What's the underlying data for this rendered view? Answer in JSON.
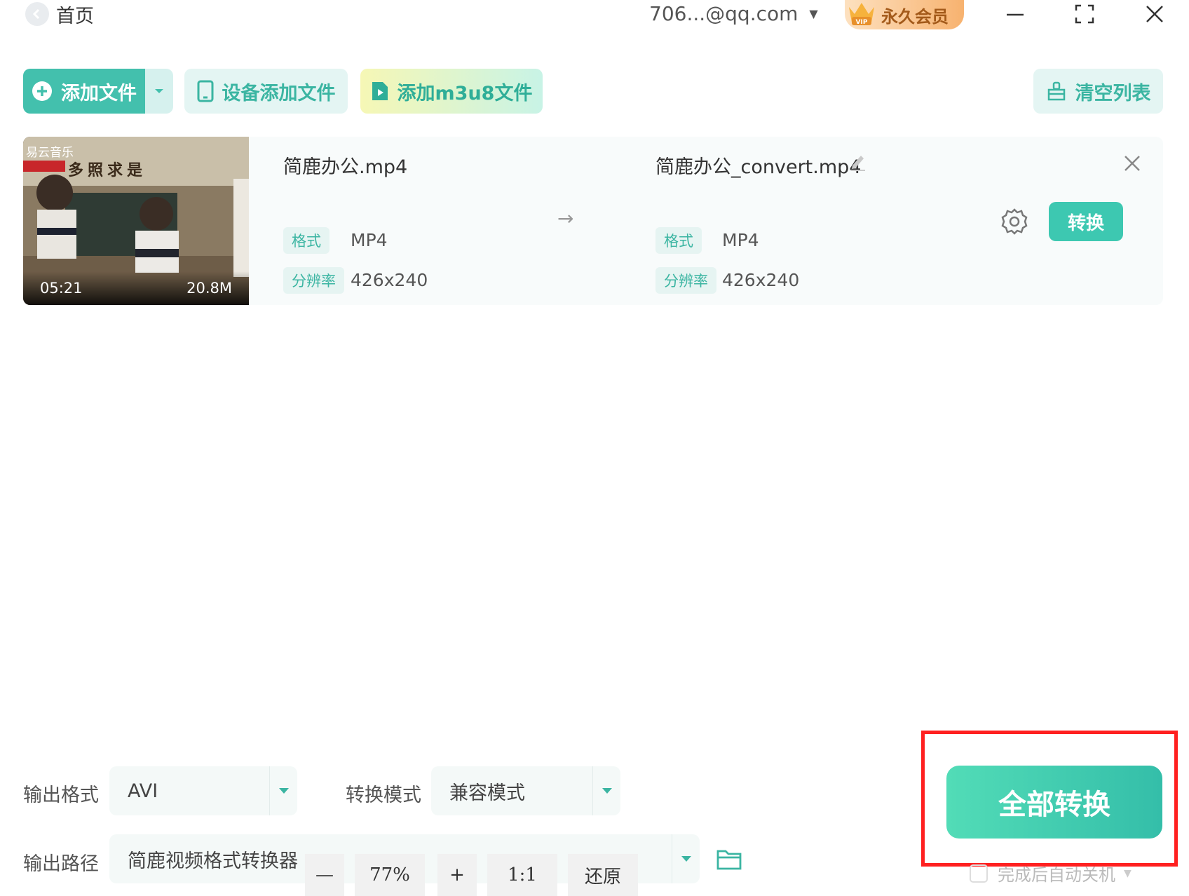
{
  "titlebar": {
    "back_label": "首页",
    "account": "706...@qq.com",
    "vip_label": "永久会员",
    "vip_icon_text": "VIP"
  },
  "toolbar": {
    "add_file": "添加文件",
    "device_add": "设备添加文件",
    "m3u8_add": "添加m3u8文件",
    "clear_list": "清空列表"
  },
  "file_row": {
    "thumb_logo": "易云音乐",
    "thumb_banner": "多照求是",
    "duration": "05:21",
    "size": "20.8M",
    "source_name": "简鹿办公.mp4",
    "target_name": "简鹿办公_convert.mp4",
    "format_label": "格式",
    "resolution_label": "分辨率",
    "source_format": "MP4",
    "source_resolution": "426x240",
    "target_format": "MP4",
    "target_resolution": "426x240",
    "convert_label": "转换"
  },
  "settings": {
    "output_format_label": "输出格式",
    "output_format_value": "AVI",
    "mode_label": "转换模式",
    "mode_value": "兼容模式",
    "output_path_label": "输出路径",
    "output_path_value": "简鹿视频格式转换器"
  },
  "zoom": {
    "minus": "—",
    "level": "77%",
    "plus": "+",
    "one_to_one": "1:1",
    "reset": "还原"
  },
  "actions": {
    "convert_all": "全部转换",
    "shutdown_label": "完成后自动关机"
  },
  "colors": {
    "accent": "#43c0ad",
    "highlight": "#ff2020"
  }
}
